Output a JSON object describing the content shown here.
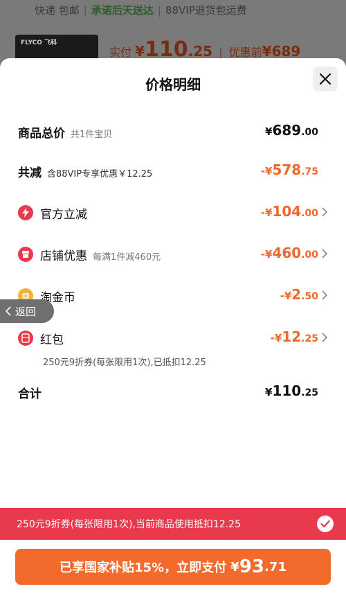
{
  "background": {
    "delivery": "快递 包邮",
    "promise": "承诺后天送达",
    "vip_return": "88VIP退货包运费",
    "logo": "FLYCO 飞科",
    "paid_label": "实付",
    "paid_currency": "¥",
    "paid_int": "110",
    "paid_dec": ".25",
    "before_label": "优惠前",
    "before_value": "¥689"
  },
  "sheet": {
    "title": "价格明细",
    "total": {
      "label": "商品总价",
      "note": "共1件宝贝",
      "currency": "¥",
      "int": "689",
      "dec": ".00"
    },
    "reduce": {
      "label": "共减",
      "note": "含88VIP专享优惠￥12.25",
      "prefix": "-¥",
      "int": "578",
      "dec": ".75"
    },
    "items": [
      {
        "label": "官方立减",
        "note": "",
        "prefix": "-¥",
        "int": "104",
        "dec": ".00",
        "icon": "lightning-icon",
        "color": "#e8394d"
      },
      {
        "label": "店铺优惠",
        "note": "每满1件减460元",
        "prefix": "-¥",
        "int": "460",
        "dec": ".00",
        "icon": "store-icon",
        "color": "#e8394d"
      },
      {
        "label": "淘金币",
        "note": "",
        "prefix": "-¥",
        "int": "2",
        "dec": ".50",
        "icon": "coin-icon",
        "color": "#f5b335"
      },
      {
        "label": "红包",
        "note": "",
        "prefix": "-¥",
        "int": "12",
        "dec": ".25",
        "icon": "red-packet-icon",
        "color": "#e8394d"
      }
    ],
    "red_packet_note": "250元9折券(每张限用1次),已抵扣12.25",
    "sum": {
      "label": "合计",
      "currency": "¥",
      "int": "110",
      "dec": ".25"
    },
    "back_label": "返回"
  },
  "bottom": {
    "coupon_text": "250元9折券(每张限用1次),当前商品使用抵扣12.25",
    "pay_prefix": "已享国家补贴15%，立即支付",
    "pay_currency": "¥",
    "pay_int": "93",
    "pay_dec": ".71"
  },
  "colors": {
    "accent_orange": "#f26a2c",
    "discount_orange": "#f0672a",
    "coupon_red": "#e8394d"
  }
}
